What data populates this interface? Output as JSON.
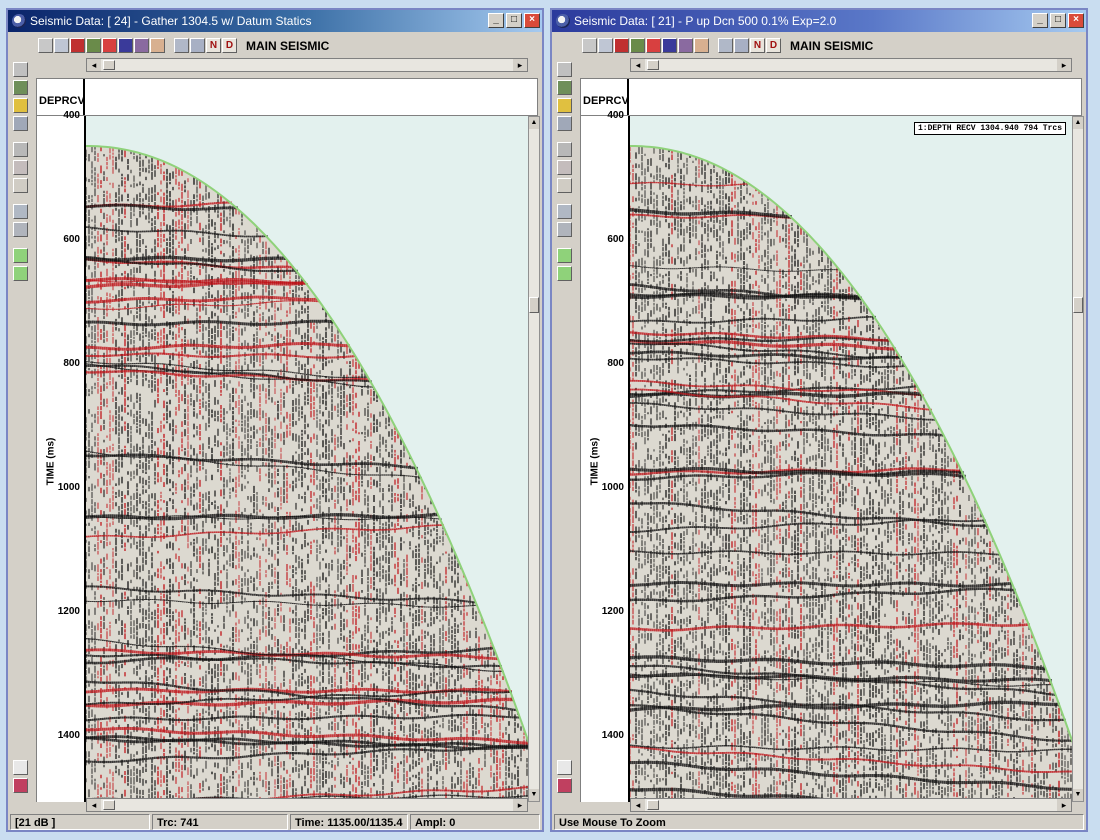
{
  "windows": [
    {
      "title": "Seismic Data: [ 24] - Gather 1304.5 w/ Datum Statics",
      "main_label": "MAIN SEISMIC",
      "header_label": "DEPRCV",
      "ylabel": "TIME (ms)",
      "yticks": [
        "400",
        "600",
        "800",
        "1000",
        "1200",
        "1400"
      ],
      "annotation": "",
      "status": [
        "[21 dB ]",
        "Trc: 741",
        "Time: 1135.00/1135.4",
        "Ampl: 0"
      ],
      "icons": [
        "minimize-icon",
        "maximize-icon",
        "close-icon"
      ]
    },
    {
      "title": "Seismic Data: [ 21] - P up Dcn 500 0.1% Exp=2.0",
      "main_label": "MAIN SEISMIC",
      "header_label": "DEPRCV",
      "ylabel": "TIME (ms)",
      "yticks": [
        "400",
        "600",
        "800",
        "1000",
        "1200",
        "1400"
      ],
      "annotation": "1:DEPTH RECV 1304.940 794 Trcs",
      "status": [
        "Use Mouse To Zoom"
      ],
      "icons": [
        "minimize-icon",
        "maximize-icon",
        "close-icon"
      ]
    }
  ],
  "toolbar": {
    "n_label": "N",
    "d_label": "D"
  },
  "colors": {
    "background": "#e3f1ee",
    "trace_black": "#111111",
    "trace_red": "#c0141a",
    "first_break": "#8fd27a"
  }
}
